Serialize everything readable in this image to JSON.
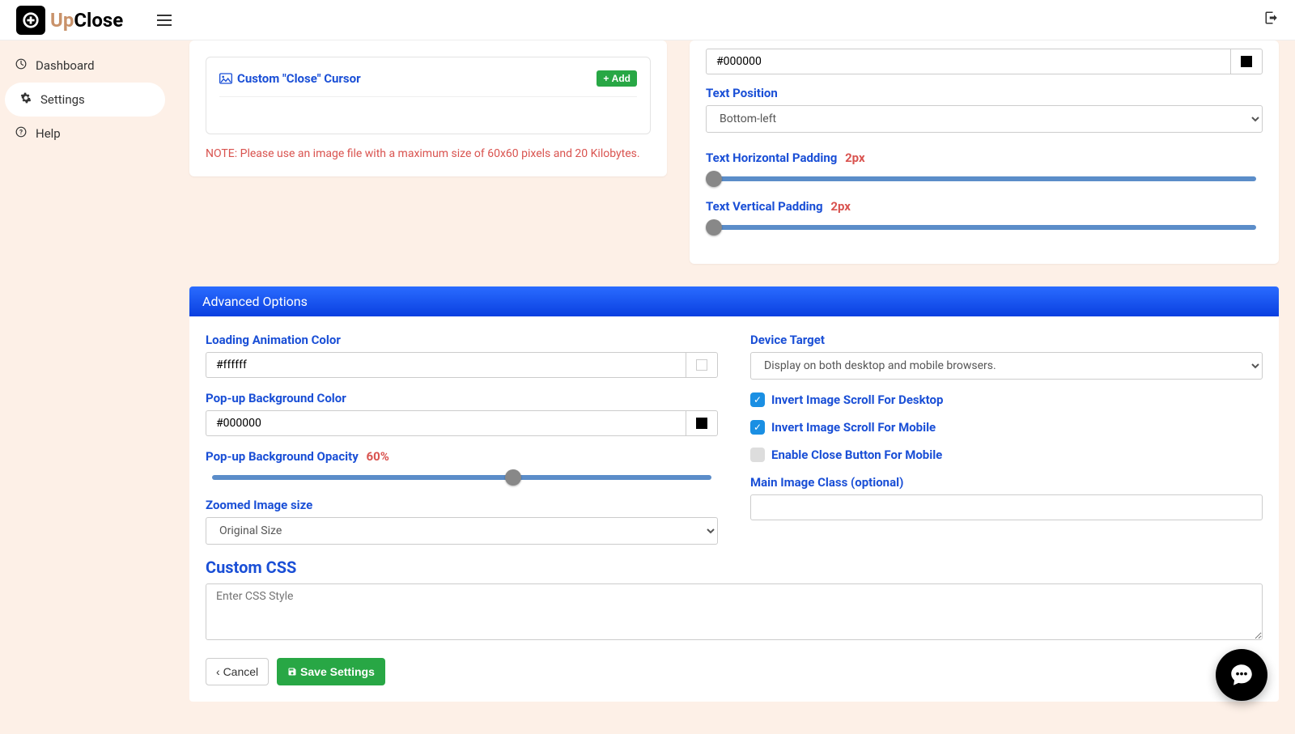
{
  "brand": {
    "up": "Up",
    "close": "Close"
  },
  "sidebar": {
    "items": [
      {
        "label": "Dashboard"
      },
      {
        "label": "Settings"
      },
      {
        "label": "Help"
      }
    ]
  },
  "cursor_card": {
    "title": "Custom \"Close\" Cursor",
    "add_label": "Add",
    "note": "NOTE: Please use an image file with a maximum size of 60x60 pixels and 20 Kilobytes."
  },
  "text_panel": {
    "color_value": "#000000",
    "color_swatch": "#000000",
    "position_label": "Text Position",
    "position_value": "Bottom-left",
    "hpad_label": "Text Horizontal Padding",
    "hpad_value": "2",
    "hpad_unit": "px",
    "vpad_label": "Text Vertical Padding",
    "vpad_value": "2",
    "vpad_unit": "px"
  },
  "advanced": {
    "title": "Advanced Options",
    "loading_color_label": "Loading Animation Color",
    "loading_color_value": "#ffffff",
    "loading_color_swatch": "#ffffff",
    "popup_bg_label": "Pop-up Background Color",
    "popup_bg_value": "#000000",
    "popup_bg_swatch": "#000000",
    "popup_opacity_label": "Pop-up Background Opacity",
    "popup_opacity_value": "60",
    "popup_opacity_unit": "%",
    "zoom_size_label": "Zoomed Image size",
    "zoom_size_value": "Original Size",
    "device_target_label": "Device Target",
    "device_target_value": "Display on both desktop and mobile browsers.",
    "invert_desktop_label": "Invert Image Scroll For Desktop",
    "invert_desktop_checked": true,
    "invert_mobile_label": "Invert Image Scroll For Mobile",
    "invert_mobile_checked": true,
    "close_mobile_label": "Enable Close Button For Mobile",
    "close_mobile_checked": false,
    "image_class_label": "Main Image Class (optional)",
    "image_class_value": "",
    "custom_css_label": "Custom CSS",
    "custom_css_placeholder": "Enter CSS Style",
    "custom_css_value": ""
  },
  "footer": {
    "cancel_label": "Cancel",
    "save_label": "Save Settings"
  }
}
